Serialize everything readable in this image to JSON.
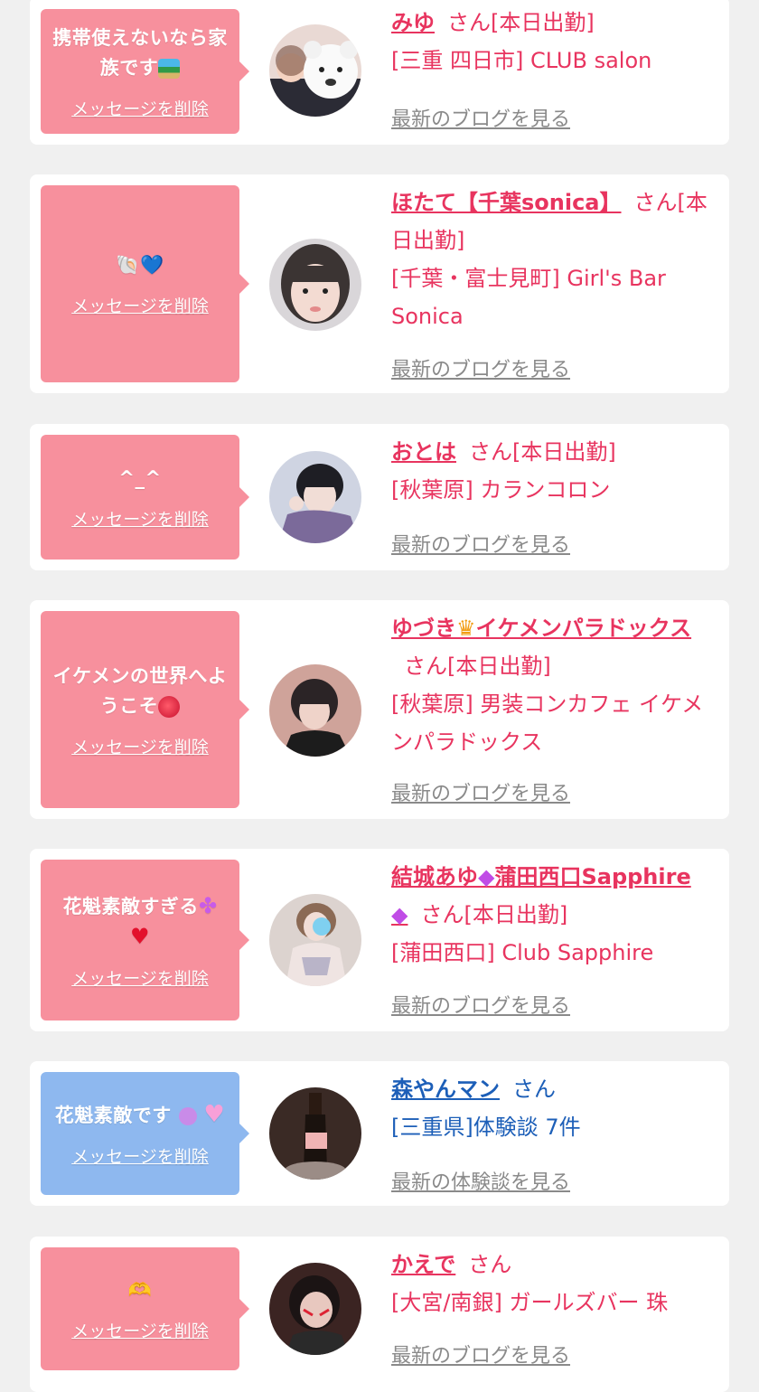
{
  "delete_label": "メッセージを削除",
  "cards": [
    {
      "message": "携帯使えないなら家族です",
      "message_icon": "beach-island-emoji",
      "name": "みゆ",
      "honorific": "さん[本日出勤]",
      "location": "[三重 四日市] CLUB salon",
      "blog_link": "最新のブログを見る"
    },
    {
      "message": "🐚💙",
      "name": "ほたて【千葉sonica】",
      "honorific": "さん[本日出勤]",
      "location": "[千葉・富士見町] Girl's Bar Sonica",
      "blog_link": "最新のブログを見る"
    },
    {
      "message": "^_^",
      "name": "おとは",
      "honorific": "さん[本日出勤]",
      "location": "[秋葉原] カランコロン",
      "blog_link": "最新のブログを見る"
    },
    {
      "message": "イケメンの世界へようこそ",
      "message_icon": "rose-emoji",
      "name": "ゆづき",
      "name_icon": "crown-emoji",
      "name_rest": "イケメンパラドックス",
      "honorific": "さん[本日出勤]",
      "location": "[秋葉原] 男装コンカフェ イケメンパラドックス",
      "blog_link": "最新のブログを見る"
    },
    {
      "message": "花魁素敵すぎる",
      "message_icons": [
        "clover-emoji",
        "heart-emoji"
      ],
      "name": "結城あゆ",
      "name_icon": "gem-emoji",
      "name_rest": "蒲田西口Sapphire",
      "name_end_icon": "gem-emoji",
      "honorific": "さん[本日出勤]",
      "location": "[蒲田西口] Club Sapphire",
      "blog_link": "最新のブログを見る"
    },
    {
      "message": "花魁素敵です",
      "message_icons": [
        "smile-emoji",
        "pink-heart-emoji"
      ],
      "name": "森やんマン",
      "honorific": "さん",
      "location": "[三重県]体験談 7件",
      "blog_link": "最新の体験談を見る"
    },
    {
      "message": "🫶",
      "name": "かえで",
      "honorific": "さん",
      "location": "[大宮/南銀] ガールズバー 珠",
      "blog_link": "最新のブログを見る"
    }
  ],
  "colors": {
    "background": "#f0f0f0",
    "card": "#ffffff",
    "bubble_pink": "#f7909d",
    "bubble_blue": "#8eb8ef",
    "name_pink": "#e8345f",
    "name_blue": "#1d5fb8",
    "blog_link": "#8a8a8a"
  }
}
